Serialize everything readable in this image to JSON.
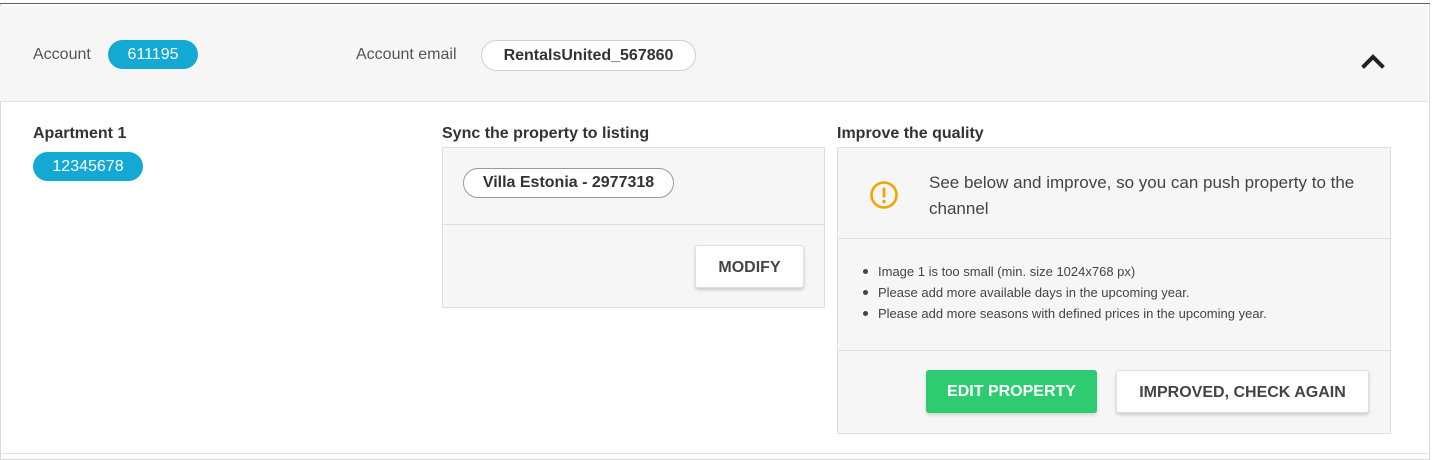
{
  "header": {
    "account_label": "Account",
    "account_value": "611195",
    "email_label": "Account email",
    "email_value": "RentalsUnited_567860",
    "collapse_icon": "chevron-up-icon"
  },
  "apartment": {
    "title": "Apartment  1",
    "id_badge": "12345678"
  },
  "sync": {
    "title": "Sync the property to  listing",
    "listing_tag": "Villa Estonia - 2977318",
    "modify_label": "MODIFY"
  },
  "quality": {
    "title": "Improve the quality",
    "warning_icon": "exclamation-circle-icon",
    "warning_text": "See below and improve, so you can push property to the channel",
    "issues": [
      "Image 1 is too small (min. size 1024x768 px)",
      "Please add more available days in the upcoming year.",
      "Please add more seasons with defined prices in the upcoming year."
    ],
    "edit_label": "EDIT PROPERTY",
    "check_label": "IMPROVED, CHECK AGAIN"
  },
  "colors": {
    "accent_blue": "#14a9d4",
    "success_green": "#2ecc71",
    "warning_orange": "#f0a500"
  }
}
